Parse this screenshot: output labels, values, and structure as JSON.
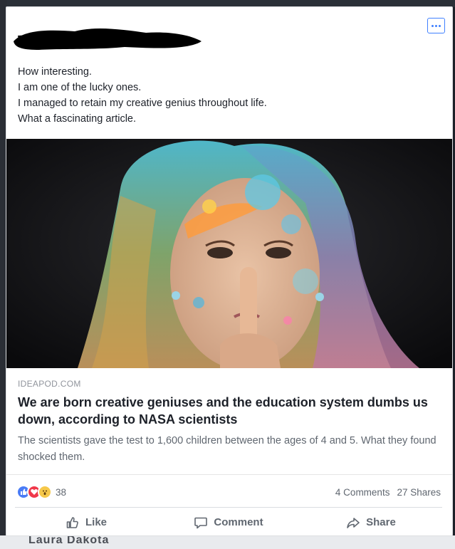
{
  "post": {
    "text_lines": [
      "How interesting.",
      "I am one of the lucky ones.",
      "I managed to retain my creative genius throughout life.",
      "What a fascinating article."
    ],
    "more_icon": "ellipsis-icon"
  },
  "link": {
    "domain": "IDEAPOD.COM",
    "title": "We are born creative geniuses and the education system dumbs us down, according to NASA scientists",
    "description": "The scientists gave the test to 1,600 children between the ages of 4 and 5. What they found shocked them."
  },
  "stats": {
    "reaction_icons": [
      "like-reaction-icon",
      "love-reaction-icon",
      "wow-reaction-icon"
    ],
    "reaction_count": "38",
    "comments": "4 Comments",
    "shares": "27 Shares"
  },
  "actions": {
    "like": "Like",
    "comment": "Comment",
    "share": "Share"
  },
  "background": {
    "partial_name": "Laura Dakota"
  },
  "colors": {
    "brand_blue": "#4080ff",
    "text_primary": "#1d2129",
    "text_secondary": "#606770",
    "like_blue": "#4a7cf6",
    "love_red": "#f0384a",
    "wow_yellow": "#f6c84a"
  }
}
